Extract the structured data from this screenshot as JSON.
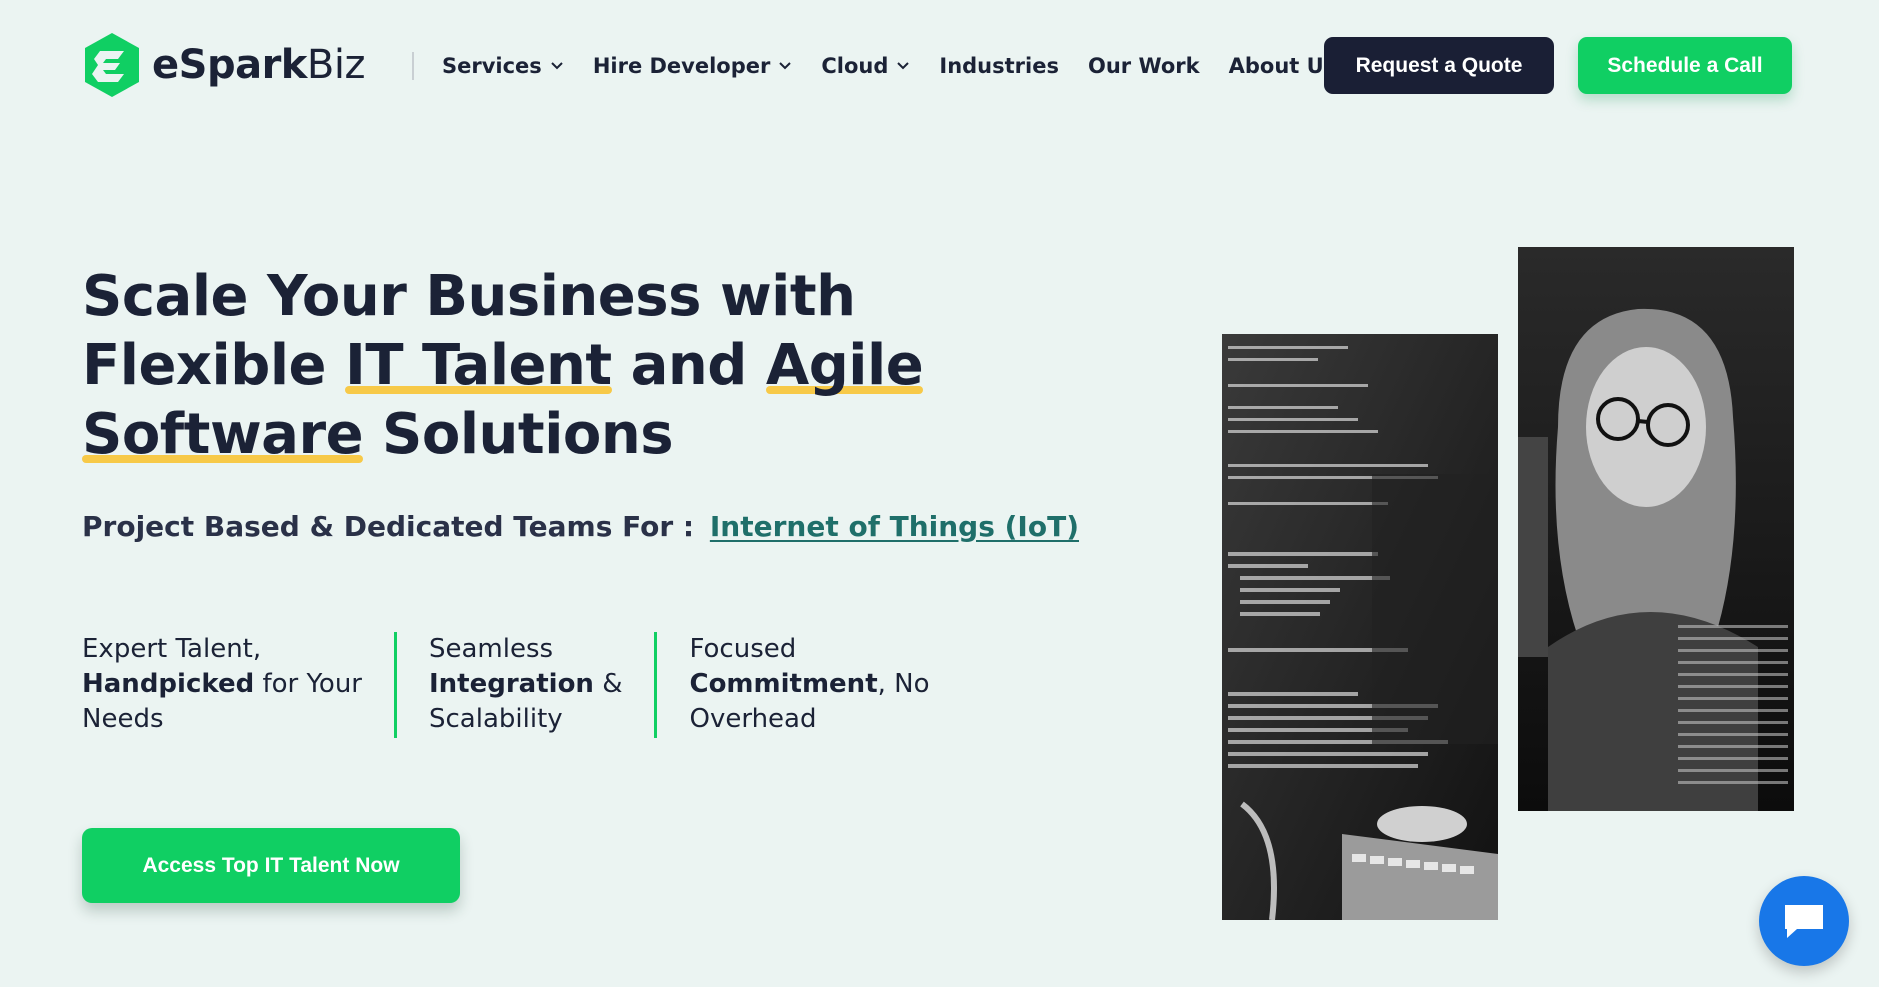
{
  "brand": {
    "name_bold": "eSpark",
    "name_light": "Biz",
    "accent": "#10cf63",
    "dark": "#1a1f35"
  },
  "nav": {
    "items": [
      {
        "label": "Services",
        "has_dropdown": true
      },
      {
        "label": "Hire Developer",
        "has_dropdown": true
      },
      {
        "label": "Cloud",
        "has_dropdown": true
      },
      {
        "label": "Industries",
        "has_dropdown": false
      },
      {
        "label": "Our Work",
        "has_dropdown": false
      },
      {
        "label": "About Us",
        "has_dropdown": true
      }
    ],
    "quote_label": "Request a Quote",
    "call_label": "Schedule a Call"
  },
  "hero": {
    "title": {
      "line1": "Scale Your Business with",
      "line2_a": "Flexible ",
      "line2_b": "IT Talent",
      "line2_c": " and ",
      "line2_d": "Agile",
      "line3_a": "Software",
      "line3_b": " Solutions"
    },
    "subtitle": "Project Based & Dedicated Teams For :",
    "subtitle_link": "Internet of Things (IoT)",
    "features": [
      {
        "pre": "Expert Talent,",
        "bold": "Handpicked",
        "post": " for Your",
        "last": "Needs"
      },
      {
        "pre": "Seamless",
        "bold": "Integration",
        "post": " &",
        "last": "Scalability"
      },
      {
        "pre": "Focused",
        "bold": "Commitment",
        "post": ", No",
        "last": "Overhead"
      }
    ],
    "cta_label": "Access Top IT Talent Now"
  },
  "icons": {
    "logo": "espark-logo-icon",
    "chevron": "chevron-down-icon",
    "chat": "chat-icon"
  }
}
